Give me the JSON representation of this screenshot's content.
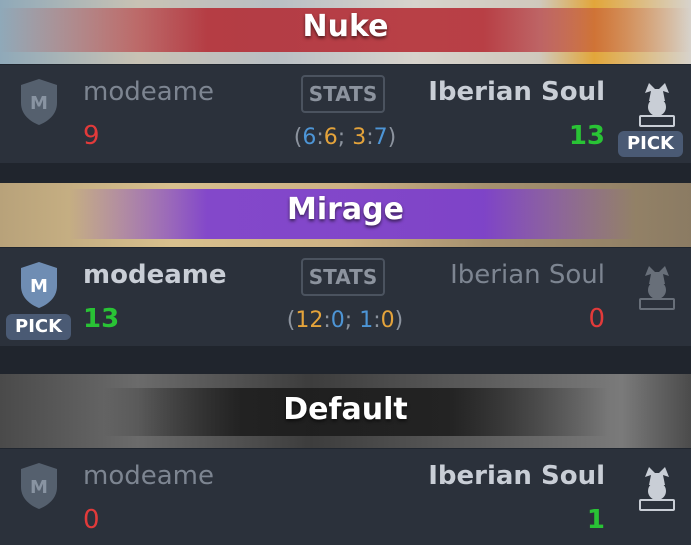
{
  "colors": {
    "panel": "#2b313b",
    "win": "#29c335",
    "lose": "#e23a3a",
    "ct": "#4d95d6",
    "t": "#e4a33b",
    "nuke_tint": "#b3262f",
    "mirage_tint": "#7a3bd1",
    "default_tint": "#1a1a1a"
  },
  "maps": [
    {
      "name": "Nuke",
      "team_left": {
        "name": "modeame",
        "score": "9",
        "logo_letter": "M"
      },
      "team_right": {
        "name": "Iberian Soul",
        "score": "13",
        "logo_text": "IBERIAN SOUL"
      },
      "stats_label": "STATS",
      "halves": {
        "open": "(",
        "a1": "6",
        "sep1": ":",
        "b1": "6",
        "mid": "; ",
        "a2": "3",
        "sep2": ":",
        "b2": "7",
        "close": ")"
      },
      "pick_label": "PICK",
      "pick_side": "right"
    },
    {
      "name": "Mirage",
      "team_left": {
        "name": "modeame",
        "score": "13",
        "logo_letter": "M"
      },
      "team_right": {
        "name": "Iberian Soul",
        "score": "0",
        "logo_text": "IBERIAN SOUL"
      },
      "stats_label": "STATS",
      "halves": {
        "open": "(",
        "a1": "12",
        "sep1": ":",
        "b1": "0",
        "mid": "; ",
        "a2": "1",
        "sep2": ":",
        "b2": "0",
        "close": ")"
      },
      "pick_label": "PICK",
      "pick_side": "left"
    },
    {
      "name": "Default",
      "team_left": {
        "name": "modeame",
        "score": "0",
        "logo_letter": "M"
      },
      "team_right": {
        "name": "Iberian Soul",
        "score": "1",
        "logo_text": "IBERIAN SOUL"
      }
    }
  ]
}
